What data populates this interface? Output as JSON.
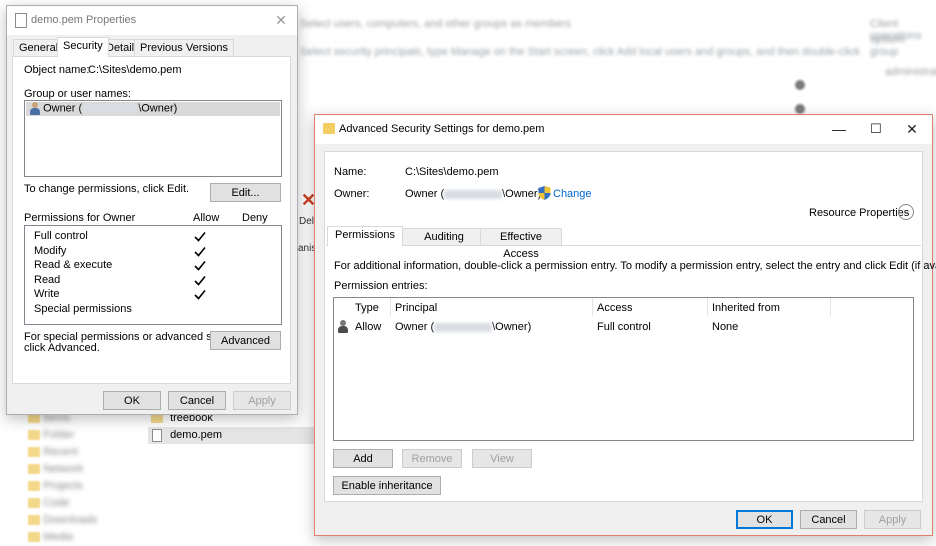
{
  "background": {
    "blurred_header_1": "Select users, computers, and other groups as members",
    "blurred_header_2": "Select security principals, type Manage on the Start screen, click Add local users and groups, and then double-click",
    "right_blur_1": "Client operations",
    "right_blur_2": "system group",
    "right_blur_3": "administrators",
    "file_rows": [
      {
        "name": "treebook",
        "type": "folder"
      },
      {
        "name": "demo.pem",
        "type": "file",
        "selected": true
      }
    ],
    "left_side_items": [
      "Items",
      "Folder",
      "Recent",
      "Network",
      "Projects",
      "Code",
      "Downloads",
      "Media"
    ],
    "ribbon_delete_label": "Dele",
    "ribbon_org_label": "anise"
  },
  "props": {
    "title": "demo.pem Properties",
    "tabs": [
      "General",
      "Security",
      "Details",
      "Previous Versions"
    ],
    "selected_tab": "Security",
    "object_name_label": "Object name:",
    "object_name_value": "C:\\Sites\\demo.pem",
    "group_label": "Group or user names:",
    "user_entry_prefix": "Owner (",
    "user_entry_suffix": "\\Owner)",
    "change_text": "To change permissions, click Edit.",
    "edit_button": "Edit...",
    "perm_label": "Permissions for Owner",
    "allow_label": "Allow",
    "deny_label": "Deny",
    "permissions": [
      {
        "name": "Full control",
        "allow": true
      },
      {
        "name": "Modify",
        "allow": true
      },
      {
        "name": "Read & execute",
        "allow": true
      },
      {
        "name": "Read",
        "allow": true
      },
      {
        "name": "Write",
        "allow": true
      },
      {
        "name": "Special permissions",
        "allow": false
      }
    ],
    "special_text_1": "For special permissions or advanced settings,",
    "special_text_2": "click Advanced.",
    "advanced_button": "Advanced",
    "ok": "OK",
    "cancel": "Cancel",
    "apply": "Apply"
  },
  "adv": {
    "title": "Advanced Security Settings for demo.pem",
    "name_label": "Name:",
    "name_value": "C:\\Sites\\demo.pem",
    "owner_label": "Owner:",
    "owner_prefix": "Owner (",
    "owner_suffix": "\\Owner)",
    "change_link": "Change",
    "resource_props": "Resource Properties",
    "tabs": [
      "Permissions",
      "Auditing",
      "Effective Access"
    ],
    "selected_tab": "Permissions",
    "info_text": "For additional information, double-click a permission entry. To modify a permission entry, select the entry and click Edit (if available).",
    "entries_label": "Permission entries:",
    "columns": [
      "Type",
      "Principal",
      "Access",
      "Inherited from"
    ],
    "rows": [
      {
        "type": "Allow",
        "principal_prefix": "Owner (",
        "principal_suffix": "\\Owner)",
        "access": "Full control",
        "inherited": "None"
      }
    ],
    "add": "Add",
    "remove": "Remove",
    "view": "View",
    "enable_inheritance": "Enable inheritance",
    "ok": "OK",
    "cancel": "Cancel",
    "apply": "Apply"
  }
}
